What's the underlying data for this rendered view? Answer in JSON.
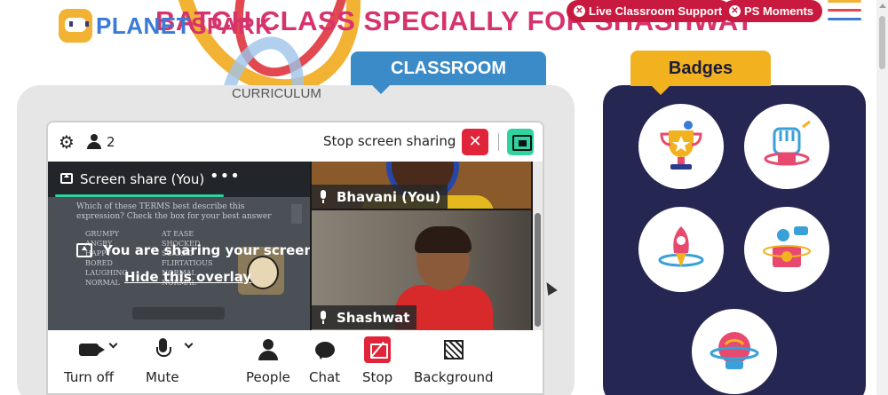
{
  "header": {
    "logo_text_a": "PLANET",
    "logo_text_b": "SPARK",
    "title": "BATCH CLASS SPECIALLY FOR SHASHWAT",
    "live_support_label": "Live Classroom Support",
    "ps_moments_label": "PS Moments"
  },
  "classroom": {
    "tab_label": "CLASSROOM",
    "curriculum_label": "CURRICULUM"
  },
  "zoom": {
    "participant_count": "2",
    "stop_share_label": "Stop screen sharing",
    "share_tile_title": "Screen share (You)",
    "more_label": "•••",
    "overlay_text": "You are sharing your screen",
    "overlay_hide_label": "Hide this overlay",
    "shared_doc": {
      "question": "Which of these TERMS best describe this expression? Check the box for your best answer",
      "options_col1": [
        "GRUMPY",
        "ANGRY",
        "HAPPY",
        "BORED",
        "LAUGHING",
        "NORMAL"
      ],
      "options_col2": [
        "AT EASE",
        "SHOCKED",
        "SCARED",
        "FLIRTATIOUS",
        "NORMAL",
        "NORMAL"
      ]
    },
    "participants": [
      {
        "name": "Bhavani (You)"
      },
      {
        "name": "Shashwat"
      }
    ],
    "controls": {
      "turn_off": "Turn off",
      "mute": "Mute",
      "people": "People",
      "chat": "Chat",
      "stop": "Stop",
      "background": "Background"
    }
  },
  "badges": {
    "tab_label": "Badges",
    "items": [
      {
        "icon": "trophy-badge-icon"
      },
      {
        "icon": "fist-badge-icon"
      },
      {
        "icon": "rocket-badge-icon"
      },
      {
        "icon": "idea-laptop-badge-icon"
      },
      {
        "icon": "brain-badge-icon"
      }
    ]
  },
  "colors": {
    "brand_pink": "#d6336c",
    "brand_blue": "#3a7bd5",
    "pill_red": "#c8193e",
    "classroom_blue": "#3b8bc9",
    "badges_yellow": "#f2b21f",
    "badges_navy": "#262652",
    "zoom_accent": "#2ed3a0",
    "stop_red": "#e0243a"
  }
}
